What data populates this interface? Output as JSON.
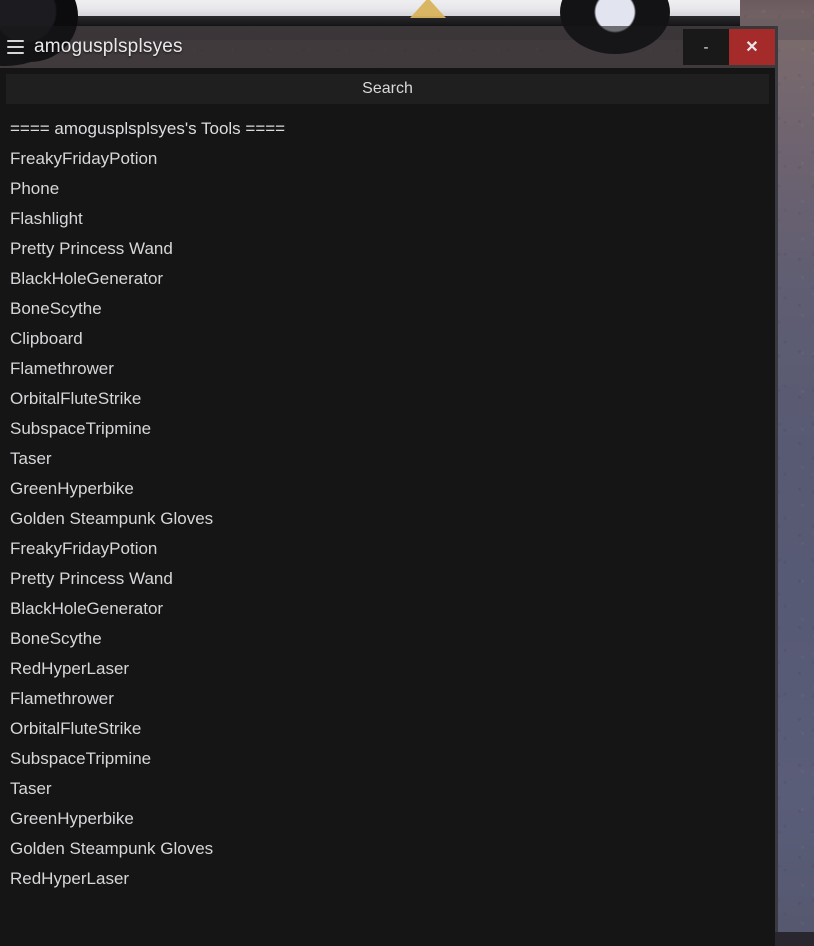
{
  "window": {
    "title": "amogusplsplsyes",
    "menu_icon": "hamburger-icon",
    "minimize_label": "-",
    "close_label": "✕",
    "accent_close_color": "#a52a2a",
    "background_color": "#151516",
    "titlebar_color": "rgba(24,24,26,0.58)",
    "text_color": "#d7d7da"
  },
  "search": {
    "placeholder": "Search",
    "value": ""
  },
  "list": {
    "header": "==== amogusplsplsyes's Tools ====",
    "items": [
      "FreakyFridayPotion",
      "Phone",
      "Flashlight",
      "Pretty Princess Wand",
      "BlackHoleGenerator",
      "BoneScythe",
      "Clipboard",
      "Flamethrower",
      "OrbitalFluteStrike",
      "SubspaceTripmine",
      "Taser",
      "GreenHyperbike",
      "Golden Steampunk Gloves",
      "FreakyFridayPotion",
      "Pretty Princess Wand",
      "BlackHoleGenerator",
      "BoneScythe",
      "RedHyperLaser",
      "Flamethrower",
      "OrbitalFluteStrike",
      "SubspaceTripmine",
      "Taser",
      "GreenHyperbike",
      "Golden Steampunk Gloves",
      "RedHyperLaser"
    ]
  }
}
